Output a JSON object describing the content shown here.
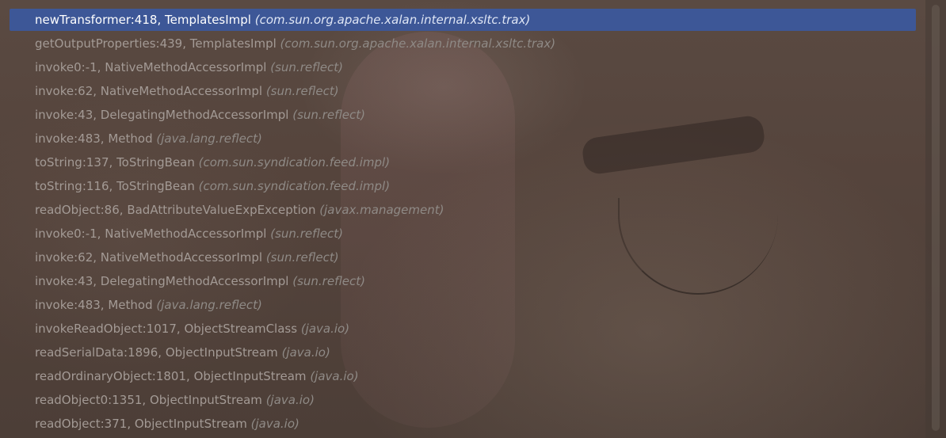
{
  "frames": [
    {
      "method": "newTransformer:418",
      "cls": "TemplatesImpl",
      "pkg": "(com.sun.org.apache.xalan.internal.xsltc.trax)",
      "selected": true
    },
    {
      "method": "getOutputProperties:439",
      "cls": "TemplatesImpl",
      "pkg": "(com.sun.org.apache.xalan.internal.xsltc.trax)",
      "selected": false
    },
    {
      "method": "invoke0:-1",
      "cls": "NativeMethodAccessorImpl",
      "pkg": "(sun.reflect)",
      "selected": false
    },
    {
      "method": "invoke:62",
      "cls": "NativeMethodAccessorImpl",
      "pkg": "(sun.reflect)",
      "selected": false
    },
    {
      "method": "invoke:43",
      "cls": "DelegatingMethodAccessorImpl",
      "pkg": "(sun.reflect)",
      "selected": false
    },
    {
      "method": "invoke:483",
      "cls": "Method",
      "pkg": "(java.lang.reflect)",
      "selected": false
    },
    {
      "method": "toString:137",
      "cls": "ToStringBean",
      "pkg": "(com.sun.syndication.feed.impl)",
      "selected": false
    },
    {
      "method": "toString:116",
      "cls": "ToStringBean",
      "pkg": "(com.sun.syndication.feed.impl)",
      "selected": false
    },
    {
      "method": "readObject:86",
      "cls": "BadAttributeValueExpException",
      "pkg": "(javax.management)",
      "selected": false
    },
    {
      "method": "invoke0:-1",
      "cls": "NativeMethodAccessorImpl",
      "pkg": "(sun.reflect)",
      "selected": false
    },
    {
      "method": "invoke:62",
      "cls": "NativeMethodAccessorImpl",
      "pkg": "(sun.reflect)",
      "selected": false
    },
    {
      "method": "invoke:43",
      "cls": "DelegatingMethodAccessorImpl",
      "pkg": "(sun.reflect)",
      "selected": false
    },
    {
      "method": "invoke:483",
      "cls": "Method",
      "pkg": "(java.lang.reflect)",
      "selected": false
    },
    {
      "method": "invokeReadObject:1017",
      "cls": "ObjectStreamClass",
      "pkg": "(java.io)",
      "selected": false
    },
    {
      "method": "readSerialData:1896",
      "cls": "ObjectInputStream",
      "pkg": "(java.io)",
      "selected": false
    },
    {
      "method": "readOrdinaryObject:1801",
      "cls": "ObjectInputStream",
      "pkg": "(java.io)",
      "selected": false
    },
    {
      "method": "readObject0:1351",
      "cls": "ObjectInputStream",
      "pkg": "(java.io)",
      "selected": false
    },
    {
      "method": "readObject:371",
      "cls": "ObjectInputStream",
      "pkg": "(java.io)",
      "selected": false
    }
  ],
  "separator": ", ",
  "colors": {
    "selection": "#3d5797",
    "text_normal": "#a39a95",
    "text_selected": "#ffffff"
  }
}
